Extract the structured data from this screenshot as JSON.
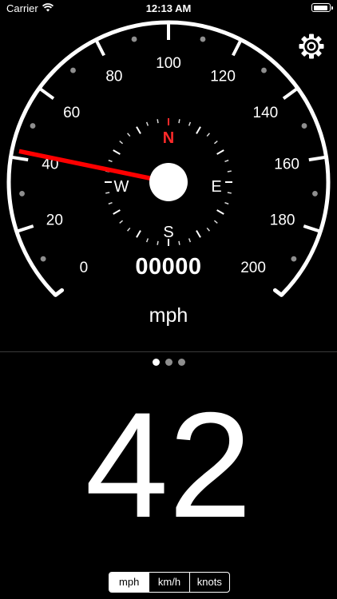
{
  "status_bar": {
    "carrier": "Carrier",
    "time": "12:13 AM"
  },
  "speedometer": {
    "scale_labels": [
      "0",
      "20",
      "40",
      "60",
      "80",
      "100",
      "120",
      "140",
      "160",
      "180",
      "200"
    ],
    "current_speed": 42,
    "needle_color": "#ff0000",
    "odometer": "00000",
    "unit": "mph"
  },
  "compass": {
    "north": "N",
    "east": "E",
    "south": "S",
    "west": "W",
    "north_color": "#ff2a2a"
  },
  "pager": {
    "count": 3,
    "active_index": 0
  },
  "big_speed": "42",
  "unit_selector": {
    "options": [
      "mph",
      "km/h",
      "knots"
    ],
    "selected": "mph"
  },
  "icons": {
    "settings": "gear-icon",
    "wifi": "wifi-icon",
    "battery": "battery-icon"
  }
}
